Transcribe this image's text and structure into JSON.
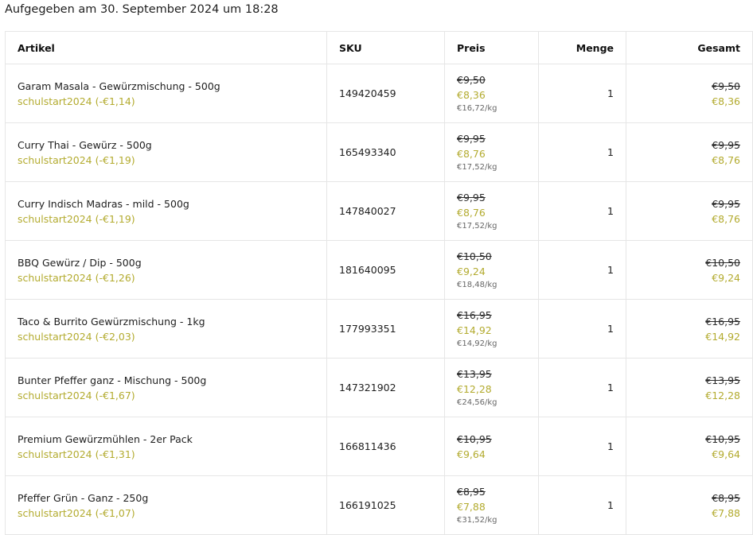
{
  "order": {
    "placed_label": "Aufgegeben am 30. September 2024 um 18:28"
  },
  "table": {
    "headers": {
      "article": "Artikel",
      "sku": "SKU",
      "price": "Preis",
      "qty": "Menge",
      "total": "Gesamt"
    },
    "rows": [
      {
        "name": "Garam Masala - Gewürzmischung - 500g",
        "coupon": "schulstart2024 (-€1,14)",
        "sku": "149420459",
        "old_price": "€9,50",
        "new_price": "€8,36",
        "unit_price": "€16,72/kg",
        "qty": "1",
        "total_old": "€9,50",
        "total_new": "€8,36"
      },
      {
        "name": "Curry Thai - Gewürz - 500g",
        "coupon": "schulstart2024 (-€1,19)",
        "sku": "165493340",
        "old_price": "€9,95",
        "new_price": "€8,76",
        "unit_price": "€17,52/kg",
        "qty": "1",
        "total_old": "€9,95",
        "total_new": "€8,76"
      },
      {
        "name": "Curry Indisch Madras - mild - 500g",
        "coupon": "schulstart2024 (-€1,19)",
        "sku": "147840027",
        "old_price": "€9,95",
        "new_price": "€8,76",
        "unit_price": "€17,52/kg",
        "qty": "1",
        "total_old": "€9,95",
        "total_new": "€8,76"
      },
      {
        "name": "BBQ Gewürz / Dip - 500g",
        "coupon": "schulstart2024 (-€1,26)",
        "sku": "181640095",
        "old_price": "€10,50",
        "new_price": "€9,24",
        "unit_price": "€18,48/kg",
        "qty": "1",
        "total_old": "€10,50",
        "total_new": "€9,24"
      },
      {
        "name": "Taco & Burrito Gewürzmischung - 1kg",
        "coupon": "schulstart2024 (-€2,03)",
        "sku": "177993351",
        "old_price": "€16,95",
        "new_price": "€14,92",
        "unit_price": "€14,92/kg",
        "qty": "1",
        "total_old": "€16,95",
        "total_new": "€14,92"
      },
      {
        "name": "Bunter Pfeffer ganz - Mischung - 500g",
        "coupon": "schulstart2024 (-€1,67)",
        "sku": "147321902",
        "old_price": "€13,95",
        "new_price": "€12,28",
        "unit_price": "€24,56/kg",
        "qty": "1",
        "total_old": "€13,95",
        "total_new": "€12,28"
      },
      {
        "name": "Premium Gewürzmühlen - 2er Pack",
        "coupon": "schulstart2024 (-€1,31)",
        "sku": "166811436",
        "old_price": "€10,95",
        "new_price": "€9,64",
        "unit_price": "",
        "qty": "1",
        "total_old": "€10,95",
        "total_new": "€9,64"
      },
      {
        "name": "Pfeffer Grün - Ganz - 250g",
        "coupon": "schulstart2024 (-€1,07)",
        "sku": "166191025",
        "old_price": "€8,95",
        "new_price": "€7,88",
        "unit_price": "€31,52/kg",
        "qty": "1",
        "total_old": "€8,95",
        "total_new": "€7,88"
      }
    ]
  },
  "colors": {
    "coupon": "#b3ab2f",
    "discount_price": "#b3ab2f",
    "border": "#e6e6e6"
  }
}
